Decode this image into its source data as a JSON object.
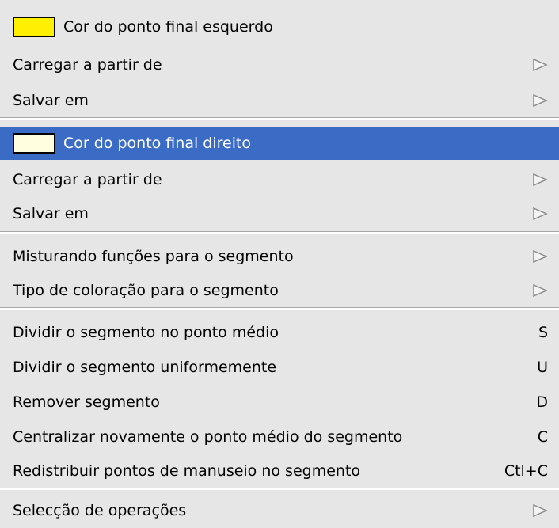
{
  "menu": {
    "left_endpoint": {
      "color_label": "Cor do ponto final esquerdo",
      "swatch_color": "#ffef00",
      "load_label": "Carregar a partir de",
      "save_label": "Salvar em"
    },
    "right_endpoint": {
      "color_label": "Cor do ponto final direito",
      "swatch_color": "#ffffe0",
      "load_label": "Carregar a partir de",
      "save_label": "Salvar em"
    },
    "segment": {
      "blend_label": "Misturando funções para o segmento",
      "coloring_label": "Tipo de coloração para o segmento"
    },
    "actions": {
      "split_mid_label": "Dividir o segmento no ponto médio",
      "split_mid_shortcut": "S",
      "split_uniform_label": "Dividir o segmento uniformemente",
      "split_uniform_shortcut": "U",
      "remove_label": "Remover segmento",
      "remove_shortcut": "D",
      "recenter_label": "Centralizar novamente o ponto médio do segmento",
      "recenter_shortcut": "C",
      "redistribute_label": "Redistribuir pontos de manuseio no segmento",
      "redistribute_shortcut": "Ctl+C"
    },
    "selection_ops_label": "Selecção de operações"
  },
  "colors": {
    "menu_background": "#e6e6e6",
    "highlight": "#3a6bc5"
  }
}
